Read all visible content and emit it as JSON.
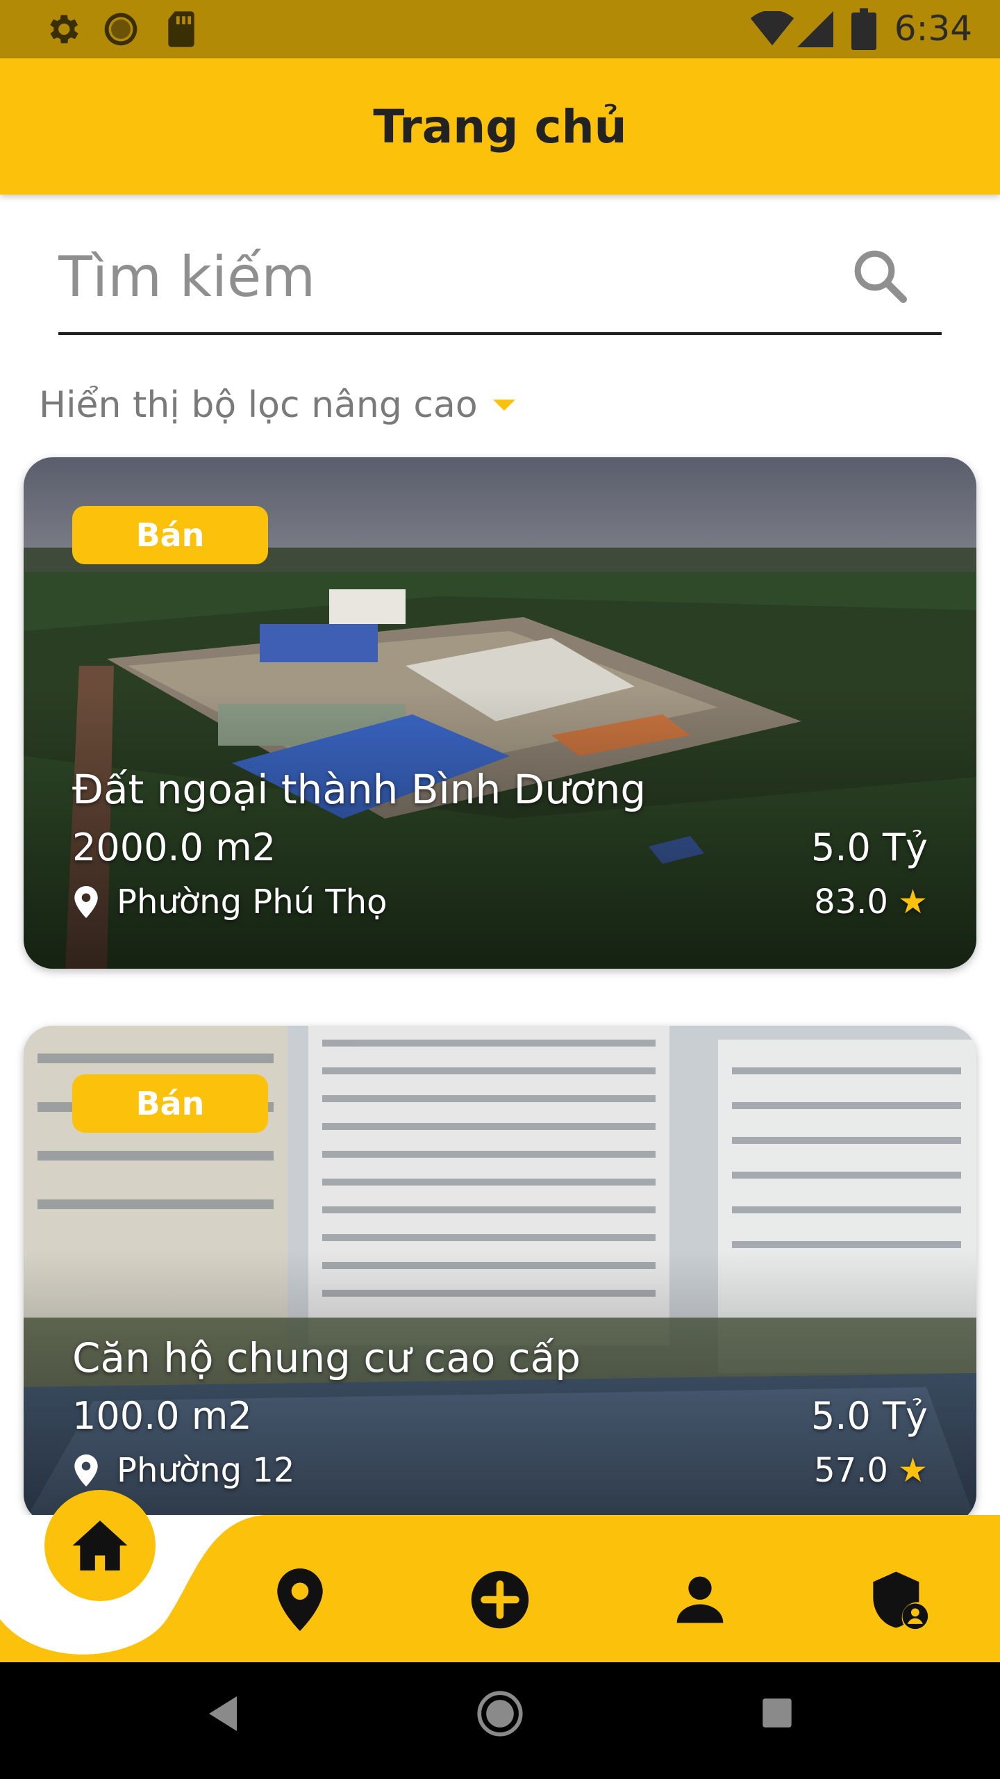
{
  "status_bar": {
    "time": "6:34",
    "left_icons": [
      "gear-icon",
      "circle-status-icon",
      "sd-card-icon"
    ],
    "right_icons": [
      "wifi-icon",
      "signal-icon",
      "battery-icon"
    ]
  },
  "app_bar": {
    "title": "Trang chủ"
  },
  "search": {
    "placeholder": "Tìm kiếm",
    "value": ""
  },
  "filter": {
    "label": "Hiển thị bộ lọc nâng cao"
  },
  "listings": [
    {
      "badge": "Bán",
      "title": "Đất ngoại thành Bình Dương",
      "area": "2000.0 m2",
      "price": "5.0 Tỷ",
      "location": "Phường Phú Thọ",
      "rating": "83.0"
    },
    {
      "badge": "Bán",
      "title": "Căn hộ chung cư cao cấp",
      "area": "100.0 m2",
      "price": "5.0 Tỷ",
      "location": "Phường 12",
      "rating": "57.0"
    }
  ],
  "bottom_nav": {
    "items": [
      "home-icon",
      "location-pin-icon",
      "add-circle-icon",
      "person-icon",
      "admin-shield-icon"
    ],
    "active": "home"
  },
  "colors": {
    "accent": "#fbc10b",
    "status_bar": "#b38a05"
  }
}
